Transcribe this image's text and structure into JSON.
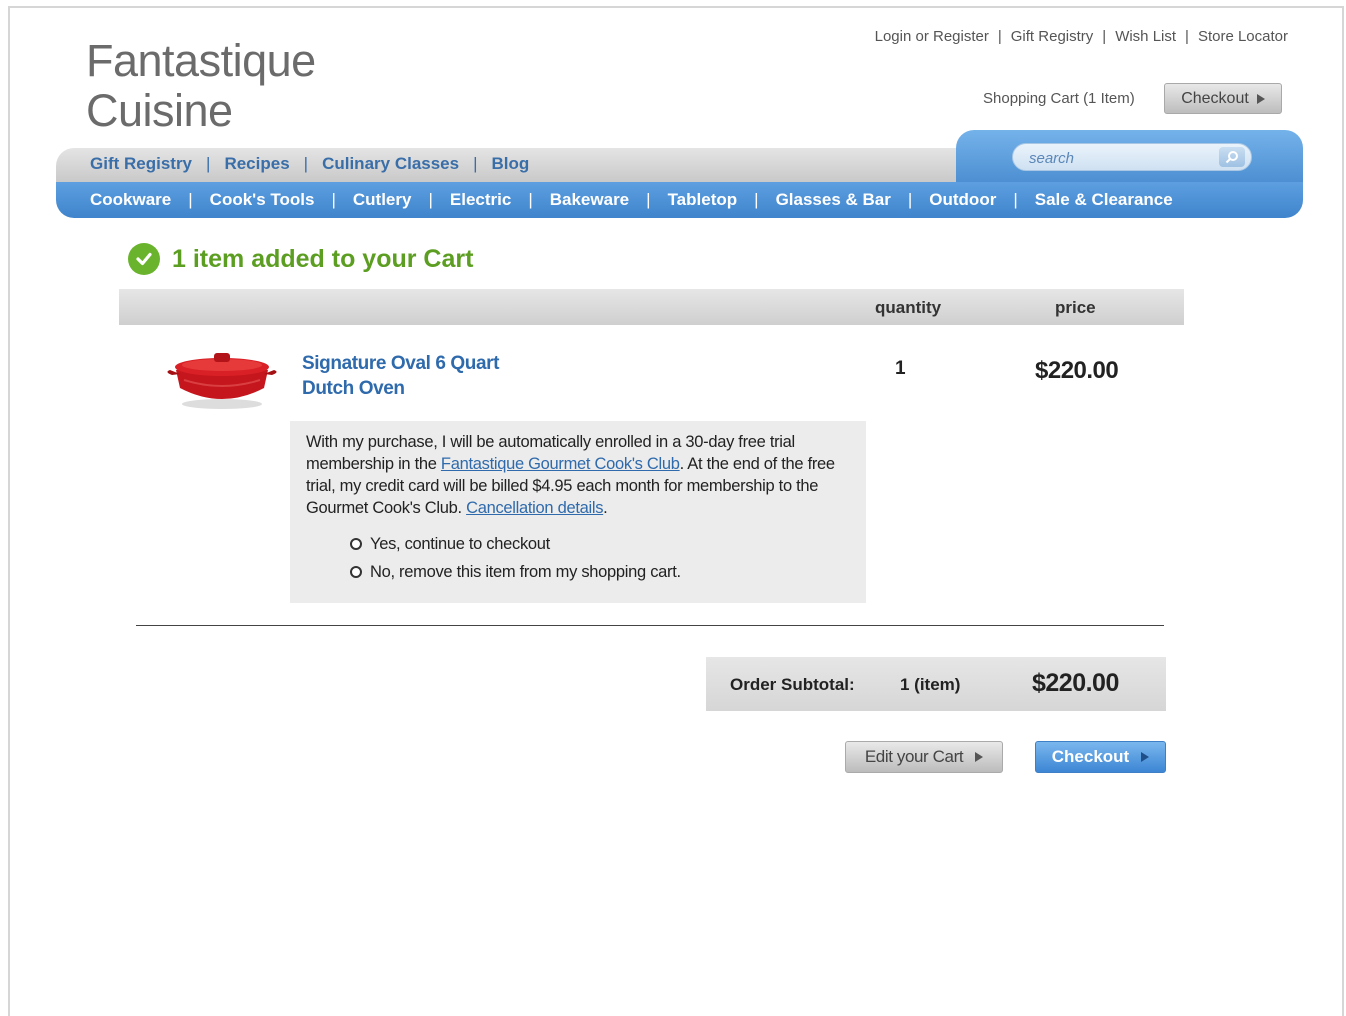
{
  "logo": {
    "line1": "Fantastique",
    "line2": "Cuisine"
  },
  "top_links": [
    "Login or Register",
    "Gift Registry",
    "Wish List",
    "Store Locator"
  ],
  "cart_summary": "Shopping Cart (1 Item)",
  "top_checkout_label": "Checkout",
  "nav_top": [
    "Gift Registry",
    "Recipes",
    "Culinary Classes",
    "Blog"
  ],
  "search": {
    "placeholder": "search"
  },
  "nav_bottom": [
    "Cookware",
    "Cook's Tools",
    "Cutlery",
    "Electric",
    "Bakeware",
    "Tabletop",
    "Glasses & Bar",
    "Outdoor",
    "Sale & Clearance"
  ],
  "added_message": "1 item added to your Cart",
  "table": {
    "quantity_header": "quantity",
    "price_header": "price"
  },
  "product": {
    "name": "Signature Oval 6 Quart Dutch Oven",
    "quantity": "1",
    "price": "$220.00"
  },
  "membership": {
    "text_1": "With my purchase, I will be automatically enrolled in a 30-day free trial membership in the ",
    "club_link": "Fantastique Gourmet Cook's Club",
    "text_2": ". At the end of the free trial, my credit card will be billed $4.95 each month for membership to the Gourmet Cook's Club. ",
    "cancel_link": "Cancellation details",
    "text_3": ".",
    "option_yes": "Yes, continue to checkout",
    "option_no": "No, remove this item from my shopping cart."
  },
  "subtotal": {
    "label": "Order Subtotal:",
    "count": "1 (item)",
    "total": "$220.00"
  },
  "buttons": {
    "edit_cart": "Edit your Cart",
    "checkout": "Checkout"
  },
  "colors": {
    "accent_blue": "#4a8fd6",
    "success_green": "#5c9e22",
    "link_blue": "#2e6aac"
  }
}
